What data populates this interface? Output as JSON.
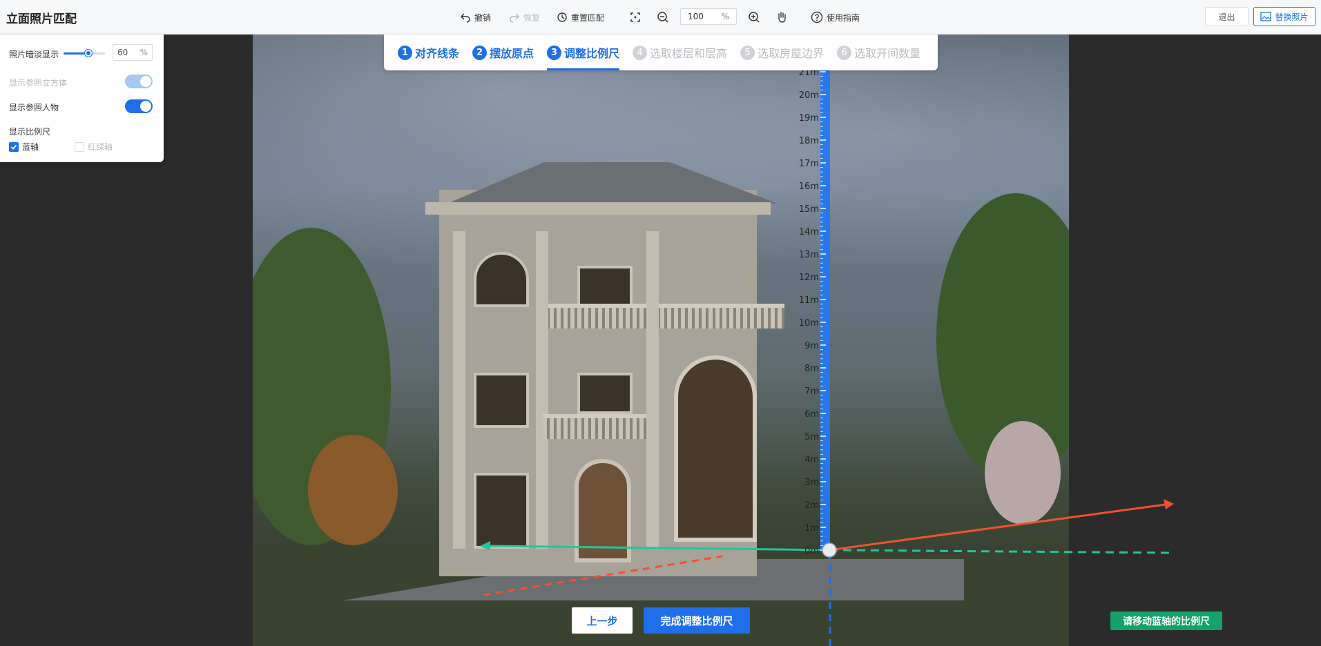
{
  "app": {
    "title": "立面照片匹配"
  },
  "toolbar": {
    "undo": "撤销",
    "redo": "恢复",
    "reset": "重置匹配",
    "zoom_value": "100",
    "zoom_unit": "%",
    "guide": "使用指南",
    "exit": "退出",
    "replace_photo": "替换照片"
  },
  "steps": [
    {
      "num": "1",
      "label": "对齐线条",
      "state": "done"
    },
    {
      "num": "2",
      "label": "摆放原点",
      "state": "done"
    },
    {
      "num": "3",
      "label": "调整比例尺",
      "state": "active"
    },
    {
      "num": "4",
      "label": "选取楼层和层高",
      "state": "todo"
    },
    {
      "num": "5",
      "label": "选取房屋边界",
      "state": "todo"
    },
    {
      "num": "6",
      "label": "选取开间数量",
      "state": "todo"
    }
  ],
  "panel": {
    "photo_fade_label": "照片暗淡显示",
    "photo_fade_value": "60",
    "photo_fade_unit": "%",
    "photo_fade_fraction": 0.6,
    "show_cube_label": "显示参照立方体",
    "show_person_label": "显示参照人物",
    "show_scale_label": "显示比例尺",
    "blue_axis_label": "蓝轴",
    "red_green_axis_label": "红绿轴"
  },
  "ruler": {
    "ticks": [
      "0m",
      "1m",
      "2m",
      "3m",
      "4m",
      "5m",
      "6m",
      "7m",
      "8m",
      "9m",
      "10m",
      "11m",
      "12m",
      "13m",
      "14m",
      "15m",
      "16m",
      "17m",
      "18m",
      "19m",
      "20m",
      "21m"
    ]
  },
  "footer": {
    "prev": "上一步",
    "finish": "完成调整比例尺",
    "hint": "请移动蓝轴的比例尺"
  },
  "colors": {
    "accent": "#1f6feb",
    "axis_red": "#f0522f",
    "axis_green": "#1fc79a",
    "hint_bg": "#12a26a"
  }
}
